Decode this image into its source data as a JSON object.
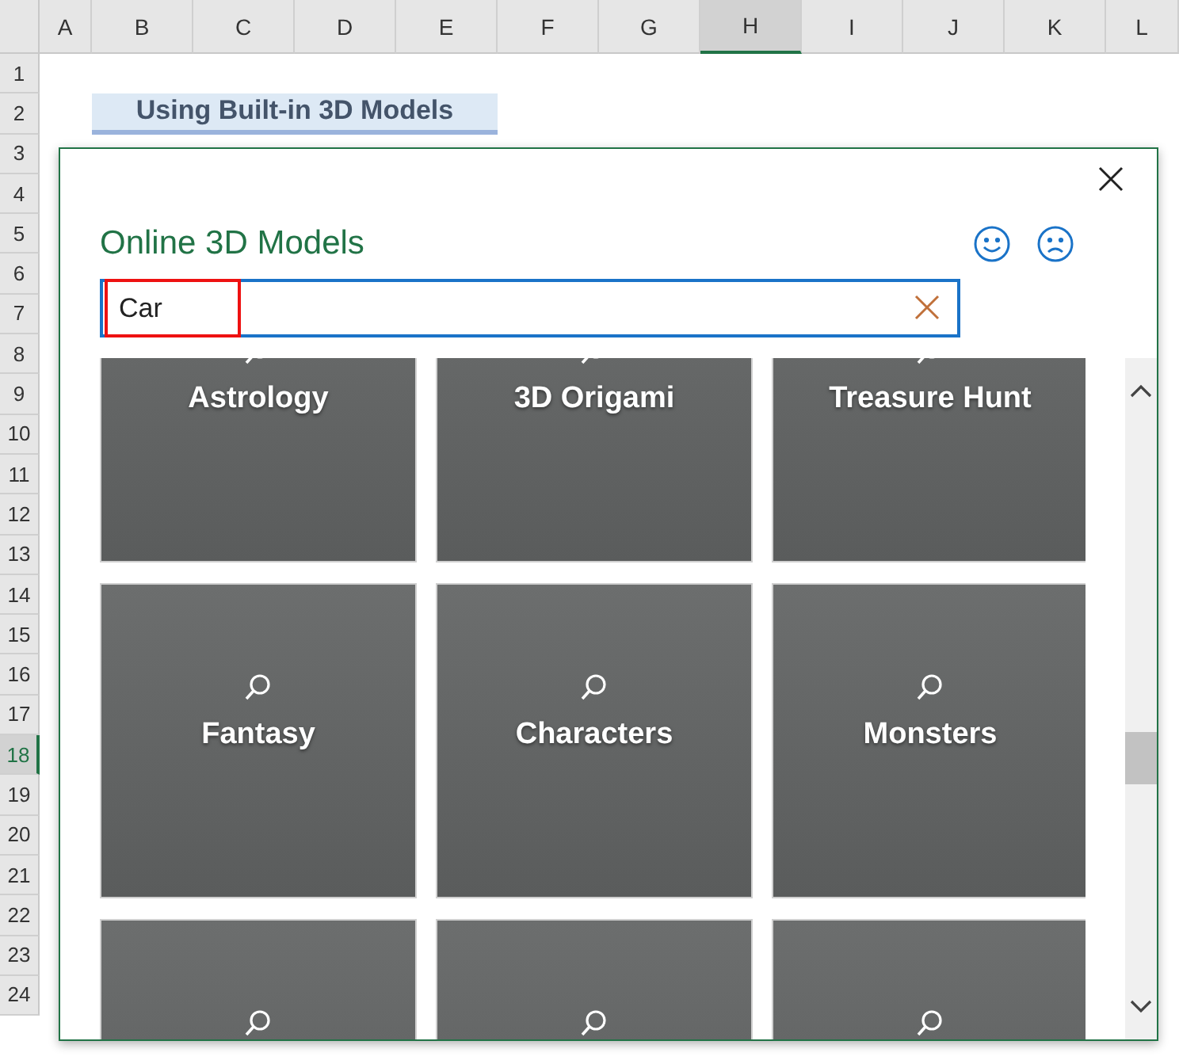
{
  "sheet": {
    "columns": [
      {
        "label": "A",
        "selected": false
      },
      {
        "label": "B",
        "selected": false
      },
      {
        "label": "C",
        "selected": false
      },
      {
        "label": "D",
        "selected": false
      },
      {
        "label": "E",
        "selected": false
      },
      {
        "label": "F",
        "selected": false
      },
      {
        "label": "G",
        "selected": false
      },
      {
        "label": "H",
        "selected": true
      },
      {
        "label": "I",
        "selected": false
      },
      {
        "label": "J",
        "selected": false
      },
      {
        "label": "K",
        "selected": false
      },
      {
        "label": "L",
        "selected": false
      }
    ],
    "rows": [
      {
        "label": "1",
        "selected": false
      },
      {
        "label": "2",
        "selected": false
      },
      {
        "label": "3",
        "selected": false
      },
      {
        "label": "4",
        "selected": false
      },
      {
        "label": "5",
        "selected": false
      },
      {
        "label": "6",
        "selected": false
      },
      {
        "label": "7",
        "selected": false
      },
      {
        "label": "8",
        "selected": false
      },
      {
        "label": "9",
        "selected": false
      },
      {
        "label": "10",
        "selected": false
      },
      {
        "label": "11",
        "selected": false
      },
      {
        "label": "12",
        "selected": false
      },
      {
        "label": "13",
        "selected": false
      },
      {
        "label": "14",
        "selected": false
      },
      {
        "label": "15",
        "selected": false
      },
      {
        "label": "16",
        "selected": false
      },
      {
        "label": "17",
        "selected": false
      },
      {
        "label": "18",
        "selected": true
      },
      {
        "label": "19",
        "selected": false
      },
      {
        "label": "20",
        "selected": false
      },
      {
        "label": "21",
        "selected": false
      },
      {
        "label": "22",
        "selected": false
      },
      {
        "label": "23",
        "selected": false
      },
      {
        "label": "24",
        "selected": false
      }
    ],
    "title_cell": "Using Built-in 3D Models"
  },
  "dialog": {
    "title": "Online 3D Models",
    "search": {
      "value": "Car",
      "highlighted": true
    },
    "tiles": [
      {
        "kind": "labeled",
        "label": "Astrology"
      },
      {
        "kind": "labeled",
        "label": "3D Origami"
      },
      {
        "kind": "labeled",
        "label": "Treasure Hunt"
      },
      {
        "kind": "labeled",
        "label": "Fantasy"
      },
      {
        "kind": "labeled",
        "label": "Characters"
      },
      {
        "kind": "labeled",
        "label": "Monsters"
      },
      {
        "kind": "plain"
      },
      {
        "kind": "plain"
      },
      {
        "kind": "plain"
      }
    ]
  }
}
